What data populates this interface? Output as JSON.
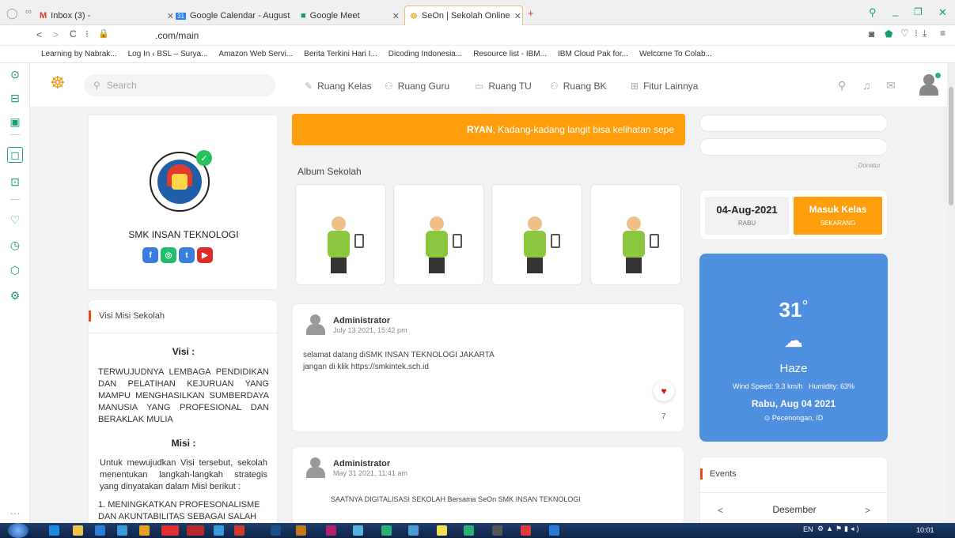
{
  "browser": {
    "tabs": [
      {
        "label": "Inbox (3) -"
      },
      {
        "label": "Google Calendar - August"
      },
      {
        "label": "Google Meet"
      },
      {
        "label": "SeOn | Sekolah Online"
      }
    ],
    "url": ".com/main",
    "bookmarks": [
      "Learning by Nabrak...",
      "Log In ‹ BSL – Surya...",
      "Amazon Web Servi...",
      "Berita Terkini Hari I...",
      "Dicoding Indonesia...",
      "Resource list - IBM...",
      "IBM Cloud Pak for...",
      "Welcome To Colab..."
    ]
  },
  "nav": {
    "search_placeholder": "Search",
    "items": [
      "Ruang Kelas",
      "Ruang Guru",
      "Ruang TU",
      "Ruang BK",
      "Fitur Lainnya"
    ]
  },
  "school": {
    "name": "SMK INSAN TEKNOLOGI",
    "social": [
      "f",
      "◎",
      "t",
      "▶"
    ]
  },
  "visi_misi": {
    "header": "Visi Misi Sekolah",
    "visi_title": "Visi :",
    "visi_text": "TERWUJUDNYA LEMBAGA PENDIDIKAN DAN PELATIHAN KEJURUAN YANG MAMPU MENGHASILKAN SUMBERDAYA MANUSIA YANG PROFESIONAL DAN BERAKLAK MULIA",
    "misi_title": "Misi :",
    "misi_text": "Untuk mewujudkan Visi tersebut, sekolah menentukan langkah-langkah strategis yang dinyatakan dalam Misi berikut :",
    "misi_item": "1. MENINGKATKAN PROFESONALISME DAN AKUNTABILITAS SEBAGAI SALAH"
  },
  "banner": {
    "name": "RYAN",
    "text": ", Kadang-kadang langit bisa kelihatan sepe"
  },
  "album": {
    "title": "Album Sekolah"
  },
  "posts": [
    {
      "author": "Administrator",
      "time": "July 13 2021, 15:42 pm",
      "line1": "selamat datang diSMK INSAN TEKNOLOGI JAKARTA",
      "line2": "jangan di klik https://smkintek.sch.id",
      "likes": "7"
    },
    {
      "author": "Administrator",
      "time": "May 31 2021, 11:41 am",
      "line1": "SAATNYA DIGITALISASI  SEKOLAH Bersama SeOn SMK INSAN TEKNOLOGI"
    }
  ],
  "donatur": "Donatur",
  "attendance": {
    "date": "04-Aug-2021",
    "day": "RABU",
    "btn_title": "Masuk Kelas",
    "btn_sub": "SEKARANG"
  },
  "weather": {
    "temp": "31",
    "deg": "°",
    "cond": "Haze",
    "wind": "Wind Speed: 9.3 km/h",
    "humidity": "Humidity: 63%",
    "date": "Rabu, Aug 04 2021",
    "loc": "Pecenongan, ID",
    "bg": "#4e8fe0"
  },
  "events": {
    "title": "Events",
    "month": "Desember",
    "prev": "<",
    "next": ">"
  },
  "taskbar": {
    "lang": "EN",
    "time": "10:01"
  },
  "colors": {
    "accent": "#ff9e0d",
    "brand": "#1a9c7a",
    "red_mark": "#e64a19"
  }
}
